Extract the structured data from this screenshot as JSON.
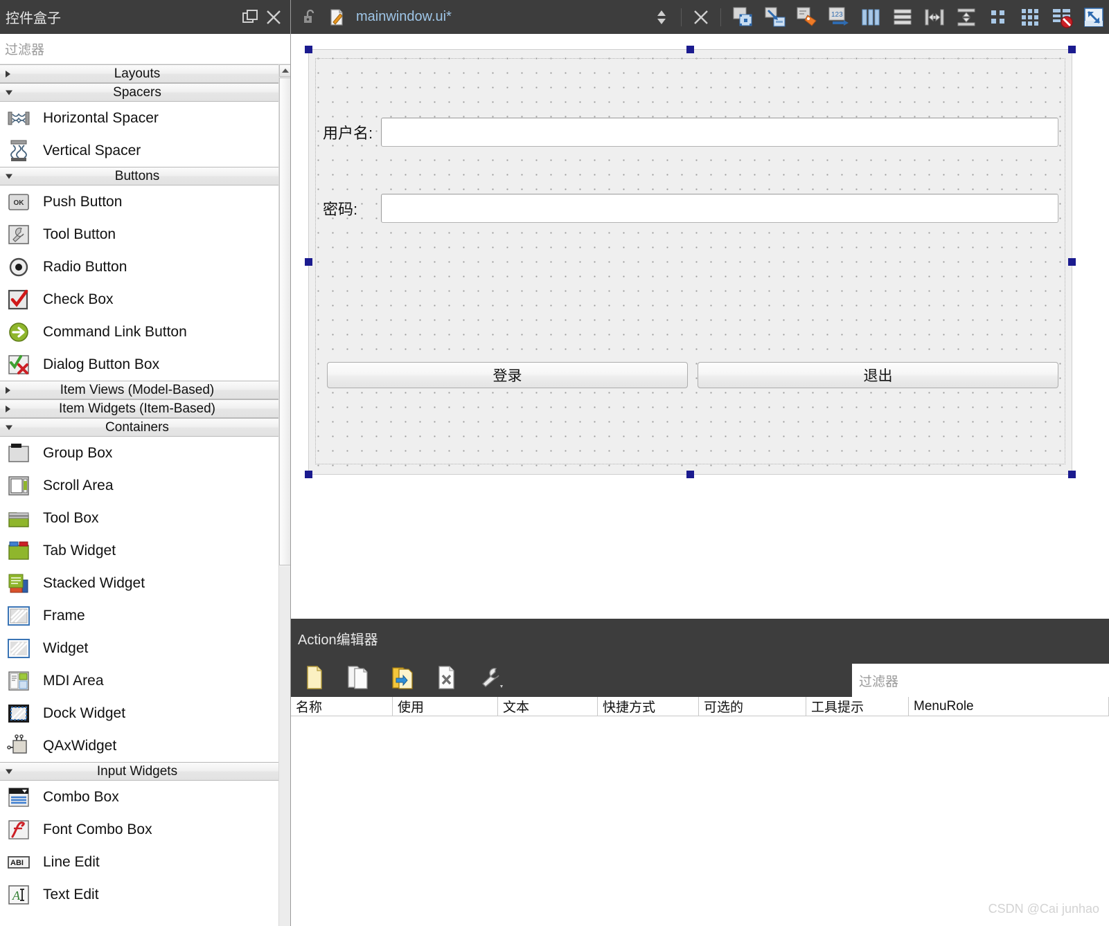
{
  "widget_box": {
    "title": "控件盒子",
    "title_buttons": [
      {
        "name": "float-icon",
        "label": "float"
      },
      {
        "name": "close-icon",
        "label": "close"
      }
    ],
    "filter_placeholder": "过滤器",
    "categories": [
      {
        "label": "Layouts",
        "expanded": false,
        "items": []
      },
      {
        "label": "Spacers",
        "expanded": true,
        "items": [
          {
            "label": "Horizontal Spacer",
            "icon": "horizontal-spacer-icon"
          },
          {
            "label": "Vertical Spacer",
            "icon": "vertical-spacer-icon"
          }
        ]
      },
      {
        "label": "Buttons",
        "expanded": true,
        "items": [
          {
            "label": "Push Button",
            "icon": "push-button-icon"
          },
          {
            "label": "Tool Button",
            "icon": "tool-button-icon"
          },
          {
            "label": "Radio Button",
            "icon": "radio-button-icon"
          },
          {
            "label": "Check Box",
            "icon": "check-box-icon"
          },
          {
            "label": "Command Link Button",
            "icon": "command-link-button-icon"
          },
          {
            "label": "Dialog Button Box",
            "icon": "dialog-button-box-icon"
          }
        ]
      },
      {
        "label": "Item Views (Model-Based)",
        "expanded": false,
        "items": []
      },
      {
        "label": "Item Widgets (Item-Based)",
        "expanded": false,
        "items": []
      },
      {
        "label": "Containers",
        "expanded": true,
        "items": [
          {
            "label": "Group Box",
            "icon": "group-box-icon"
          },
          {
            "label": "Scroll Area",
            "icon": "scroll-area-icon"
          },
          {
            "label": "Tool Box",
            "icon": "tool-box-icon"
          },
          {
            "label": "Tab Widget",
            "icon": "tab-widget-icon"
          },
          {
            "label": "Stacked Widget",
            "icon": "stacked-widget-icon"
          },
          {
            "label": "Frame",
            "icon": "frame-icon"
          },
          {
            "label": "Widget",
            "icon": "widget-icon"
          },
          {
            "label": "MDI Area",
            "icon": "mdi-area-icon"
          },
          {
            "label": "Dock Widget",
            "icon": "dock-widget-icon"
          },
          {
            "label": "QAxWidget",
            "icon": "qax-widget-icon"
          }
        ]
      },
      {
        "label": "Input Widgets",
        "expanded": true,
        "items": [
          {
            "label": "Combo Box",
            "icon": "combo-box-icon"
          },
          {
            "label": "Font Combo Box",
            "icon": "font-combo-box-icon"
          },
          {
            "label": "Line Edit",
            "icon": "line-edit-icon"
          },
          {
            "label": "Text Edit",
            "icon": "text-edit-icon"
          }
        ]
      }
    ]
  },
  "form_window": {
    "filename": "mainwindow.ui*",
    "lock_icon": "unlock-icon",
    "doc_icon": "edit-document-icon",
    "stepper_icon": "up-down-arrows-icon",
    "close_icon": "close-icon",
    "toolbar": [
      {
        "name": "edit-widgets-tool",
        "title": "Edit Widgets"
      },
      {
        "name": "edit-signals-slots-tool",
        "title": "Edit Signals/Slots"
      },
      {
        "name": "edit-buddies-tool",
        "title": "Edit Buddies"
      },
      {
        "name": "edit-tab-order-tool",
        "title": "Edit Tab Order"
      },
      {
        "name": "layout-horizontally-tool",
        "title": "Lay Out Horizontally"
      },
      {
        "name": "layout-vertically-tool",
        "title": "Lay Out Vertically"
      },
      {
        "name": "layout-splitter-horizontal-tool",
        "title": "Lay Out Horizontally in Splitter"
      },
      {
        "name": "layout-splitter-vertical-tool",
        "title": "Lay Out Vertically in Splitter"
      },
      {
        "name": "layout-form-tool",
        "title": "Lay Out in a Form Layout"
      },
      {
        "name": "layout-grid-tool",
        "title": "Lay Out in a Grid"
      },
      {
        "name": "break-layout-tool",
        "title": "Break Layout"
      },
      {
        "name": "adjust-size-tool",
        "title": "Adjust Size"
      }
    ]
  },
  "form": {
    "fields": [
      {
        "label": "用户名:",
        "value": "",
        "name": "username"
      },
      {
        "label": "密码:",
        "value": "",
        "name": "password"
      }
    ],
    "buttons": [
      {
        "label": "登录",
        "name": "login"
      },
      {
        "label": "退出",
        "name": "exit"
      }
    ]
  },
  "action_editor": {
    "title": "Action编辑器",
    "toolbar": [
      {
        "name": "new-action-icon",
        "title": "New"
      },
      {
        "name": "copy-action-icon",
        "title": "Copy"
      },
      {
        "name": "paste-action-icon",
        "title": "Paste"
      },
      {
        "name": "delete-action-icon",
        "title": "Delete"
      },
      {
        "name": "configure-icon",
        "title": "Configure"
      }
    ],
    "filter_placeholder": "过滤器",
    "columns": [
      "名称",
      "使用",
      "文本",
      "快捷方式",
      "可选的",
      "工具提示",
      "MenuRole"
    ],
    "rows": []
  },
  "watermark": "CSDN @Cai junhao",
  "colors": {
    "dock_header": "#3d3d3d",
    "form_background": "#efefef",
    "filename_accent": "#9fc6e8",
    "selection_handle": "#1b1b8f"
  }
}
